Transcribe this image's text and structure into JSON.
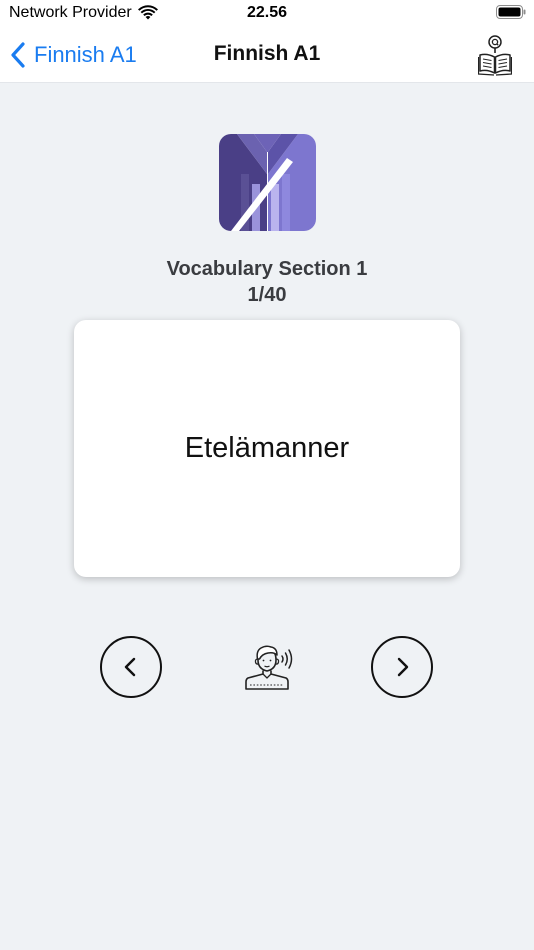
{
  "status_bar": {
    "carrier": "Network Provider",
    "time": "22.56"
  },
  "nav": {
    "back_label": "Finnish A1",
    "title": "Finnish A1"
  },
  "section": {
    "title": "Vocabulary Section 1",
    "progress": "1/40"
  },
  "flashcard": {
    "word": "Etelämanner"
  },
  "colors": {
    "accent": "#1a7cf0",
    "background": "#eff2f5",
    "logo_dark": "#4a3f86",
    "logo_light": "#8c86d8"
  },
  "icons": {
    "back": "chevron-left-icon",
    "book": "book-search-icon",
    "prev": "chevron-left-icon",
    "next": "chevron-right-icon",
    "speak": "speaking-person-icon"
  }
}
